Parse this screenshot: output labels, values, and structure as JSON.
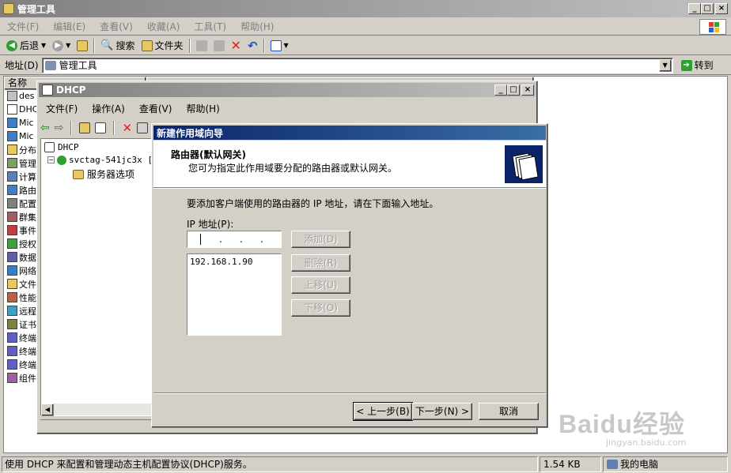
{
  "explorer": {
    "title": "管理工具",
    "menu": [
      "文件(F)",
      "编辑(E)",
      "查看(V)",
      "收藏(A)",
      "工具(T)",
      "帮助(H)"
    ],
    "toolbar": {
      "back": "后退",
      "search": "搜索",
      "folders": "文件夹"
    },
    "address_label": "地址(D)",
    "address_value": "管理工具",
    "go_label": "转到",
    "column_name": "名称",
    "list_items": [
      "des",
      "DHC",
      "Mic",
      "Mic",
      "分布",
      "管理",
      "计算",
      "路由",
      "配置",
      "群集",
      "事件",
      "授权",
      "数据",
      "网络",
      "文件",
      "性能",
      "远程",
      "证书",
      "终端",
      "终端",
      "终端",
      "组件"
    ],
    "status_text": "使用 DHCP 来配置和管理动态主机配置协议(DHCP)服务。",
    "status_size": "1.54 KB",
    "status_computer": "我的电脑"
  },
  "dhcp": {
    "title": "DHCP",
    "menu": [
      "文件(F)",
      "操作(A)",
      "查看(V)",
      "帮助(H)"
    ],
    "tree_root": "DHCP",
    "tree_server": "svctag-541jc3x [",
    "tree_options": "服务器选项"
  },
  "wizard": {
    "title": "新建作用域向导",
    "header_title": "路由器(默认网关)",
    "header_subtitle": "您可为指定此作用域要分配的路由器或默认网关。",
    "instruction": "要添加客户端使用的路由器的 IP 地址，请在下面输入地址。",
    "ip_label": "IP 地址(P):",
    "ip_value": "",
    "ip_list": [
      "192.168.1.90"
    ],
    "buttons": {
      "add": "添加(D)",
      "remove": "删除(R)",
      "up": "上移(U)",
      "down": "下移(O)",
      "back": "< 上一步(B)",
      "next": "下一步(N) >",
      "cancel": "取消"
    }
  },
  "watermark": {
    "brand": "Baidu经验",
    "url": "jingyan.baidu.com"
  },
  "colors": {
    "title_active": "#0a246a",
    "title_gradient_end": "#3a6ea5",
    "face": "#d4d0c8"
  }
}
